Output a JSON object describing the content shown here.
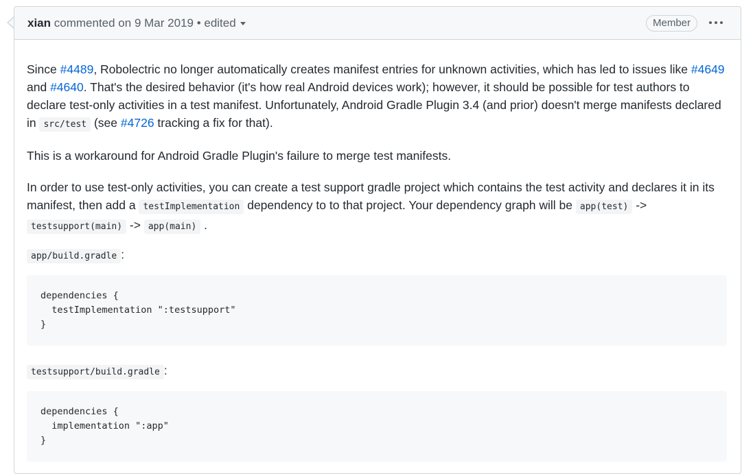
{
  "header": {
    "author": "xian",
    "action": "commented on",
    "date": "9 Mar 2019",
    "separator": "•",
    "edited": "edited",
    "badge": "Member"
  },
  "body": {
    "p1": {
      "t1": "Since ",
      "link1": "#4489",
      "t2": ", Robolectric no longer automatically creates manifest entries for unknown activities, which has led to issues like ",
      "link2": "#4649",
      "t3": " and ",
      "link3": "#4640",
      "t4": ". That's the desired behavior (it's how real Android devices work); however, it should be possible for test authors to declare test-only activities in a test manifest. Unfortunately, Android Gradle Plugin 3.4 (and prior) doesn't merge manifests declared in ",
      "code1": "src/test",
      "t5": " (see ",
      "link4": "#4726",
      "t6": " tracking a fix for that)."
    },
    "p2": "This is a workaround for Android Gradle Plugin's failure to merge test manifests.",
    "p3": {
      "t1": "In order to use test-only activities, you can create a test support gradle project which contains the test activity and declares it in its manifest, then add a ",
      "code1": "testImplementation",
      "t2": " dependency to to that project. Your dependency graph will be ",
      "code2": "app(test)",
      "t3": " -> ",
      "code3": "testsupport(main)",
      "t4": " -> ",
      "code4": "app(main)",
      "t5": " ."
    },
    "file1": "app/build.gradle",
    "file1_suffix": ":",
    "code_block1": "dependencies {\n  testImplementation \":testsupport\"\n}",
    "file2": "testsupport/build.gradle",
    "file2_suffix": ":",
    "code_block2": "dependencies {\n  implementation \":app\"\n}"
  }
}
